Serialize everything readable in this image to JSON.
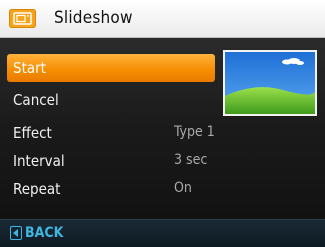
{
  "header": {
    "title": "Slideshow",
    "icon": "slideshow-icon",
    "icon_color": "#f6a419"
  },
  "menu": {
    "start": "Start",
    "cancel": "Cancel"
  },
  "settings": [
    {
      "label": "Effect",
      "value": "Type 1"
    },
    {
      "label": "Interval",
      "value": "3 sec"
    },
    {
      "label": "Repeat",
      "value": "On"
    }
  ],
  "footer": {
    "back_label": "BACK",
    "back_icon": "back-arrow-icon"
  },
  "colors": {
    "highlight": "#f58c00",
    "accent": "#3fb6e0"
  }
}
